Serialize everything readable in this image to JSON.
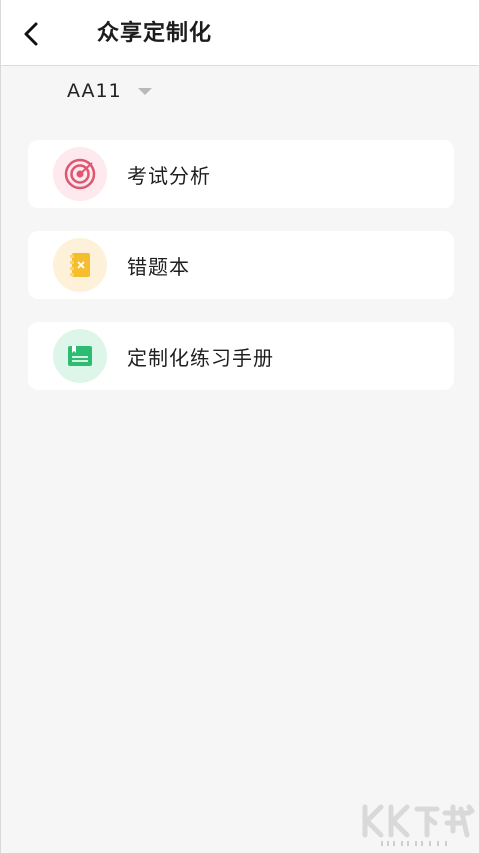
{
  "header": {
    "title": "众享定制化",
    "back_icon": "chevron-left-icon"
  },
  "selector": {
    "value": "AA11",
    "icon": "caret-down-icon"
  },
  "menu": {
    "items": [
      {
        "label": "考试分析",
        "icon": "target-icon",
        "circle_color": "#fde9ee",
        "accent": "#e0556f"
      },
      {
        "label": "错题本",
        "icon": "notebook-error-icon",
        "circle_color": "#fdf2d9",
        "accent": "#f5be2e"
      },
      {
        "label": "定制化练习手册",
        "icon": "workbook-icon",
        "circle_color": "#def6ea",
        "accent": "#2dbd72"
      }
    ]
  },
  "watermark": {
    "brand": "KK下载",
    "url": "www.kkx.net"
  }
}
